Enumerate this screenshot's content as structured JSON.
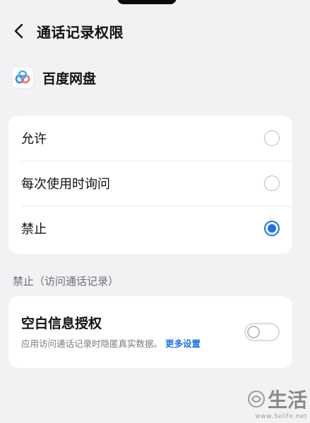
{
  "header": {
    "title": "通话记录权限"
  },
  "app": {
    "name": "百度网盘"
  },
  "options": [
    {
      "label": "允许",
      "selected": false
    },
    {
      "label": "每次使用时询问",
      "selected": false
    },
    {
      "label": "禁止",
      "selected": true
    }
  ],
  "section_label": "禁止（访问通话记录）",
  "blank_info": {
    "title": "空白信息授权",
    "description": "应用访问通话记录时隐匿真实数据。",
    "link": "更多设置",
    "enabled": false
  },
  "watermark": {
    "text": "生活",
    "url": "www.3elife.net"
  },
  "colors": {
    "accent": "#1a73e8",
    "background": "#f2f2f4"
  }
}
